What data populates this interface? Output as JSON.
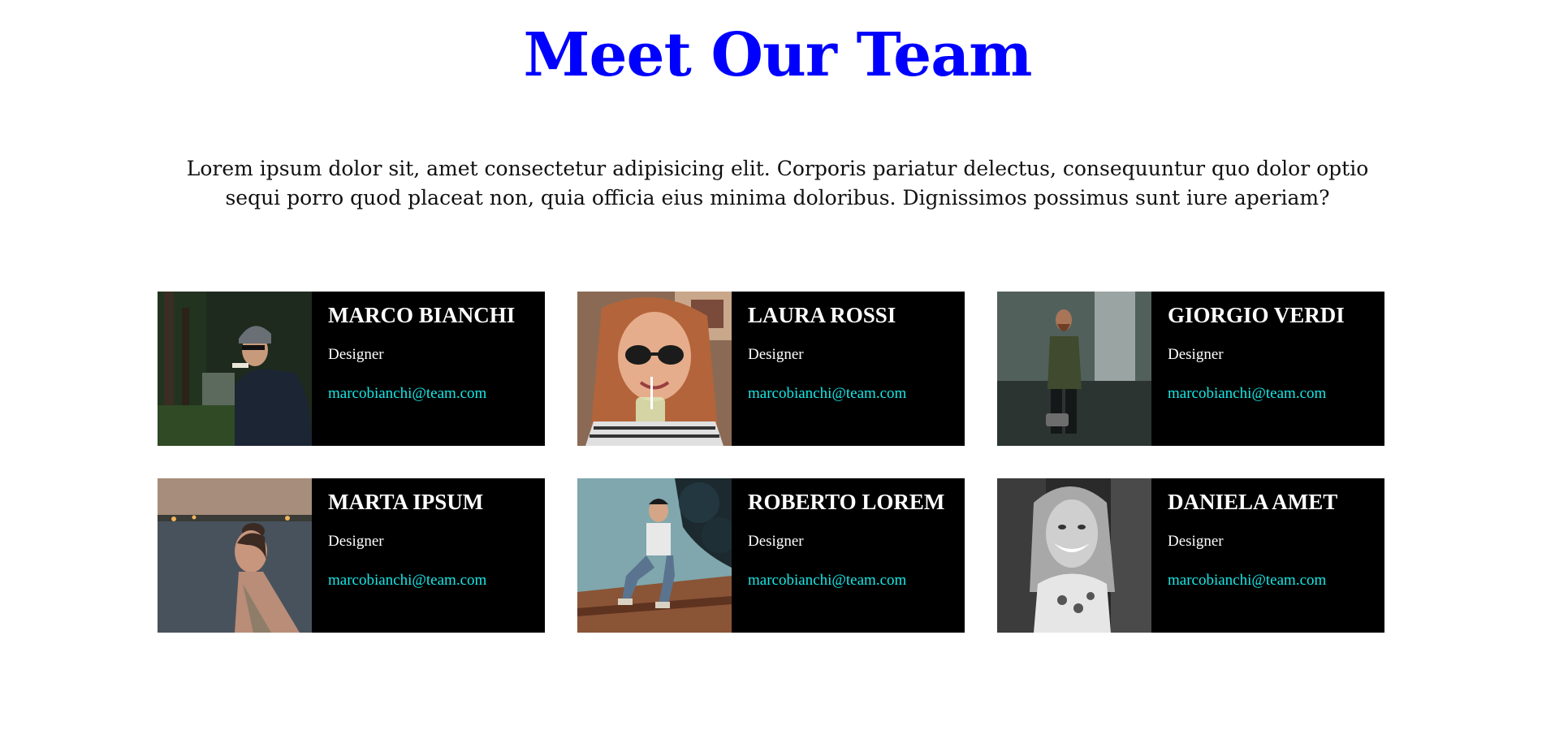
{
  "header": {
    "title": "Meet Our Team",
    "intro": "Lorem ipsum dolor sit, amet consectetur adipisicing elit. Corporis pariatur delectus, consequuntur quo dolor optio sequi porro quod placeat non, quia officia eius minima doloribus. Dignissimos possimus sunt iure aperiam?"
  },
  "colors": {
    "title": "#0000ff",
    "card_background": "#000000",
    "name_text": "#ffffff",
    "email_link": "#18e6e6"
  },
  "team": [
    {
      "name": "MARCO BIANCHI",
      "role": "Designer",
      "email": "marcobianchi@team.com"
    },
    {
      "name": "LAURA ROSSI",
      "role": "Designer",
      "email": "marcobianchi@team.com"
    },
    {
      "name": "GIORGIO VERDI",
      "role": "Designer",
      "email": "marcobianchi@team.com"
    },
    {
      "name": "MARTA IPSUM",
      "role": "Designer",
      "email": "marcobianchi@team.com"
    },
    {
      "name": "ROBERTO LOREM",
      "role": "Designer",
      "email": "marcobianchi@team.com"
    },
    {
      "name": "DANIELA AMET",
      "role": "Designer",
      "email": "marcobianchi@team.com"
    }
  ]
}
